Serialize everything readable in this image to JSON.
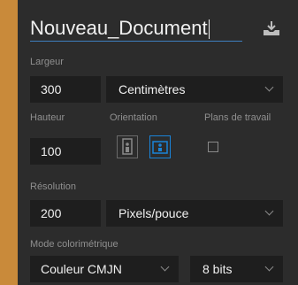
{
  "document": {
    "name": "Nouveau_Document"
  },
  "width": {
    "label": "Largeur",
    "value": "300",
    "unit": "Centimètres"
  },
  "height": {
    "label": "Hauteur",
    "value": "100"
  },
  "orientation": {
    "label": "Orientation",
    "selected": "landscape"
  },
  "artboards": {
    "label": "Plans de travail",
    "checked": false
  },
  "resolution": {
    "label": "Résolution",
    "value": "200",
    "unit": "Pixels/pouce"
  },
  "color_mode": {
    "label": "Mode colorimétrique",
    "value": "Couleur CMJN",
    "bit_depth": "8 bits"
  },
  "colors": {
    "accent": "#1a84d8",
    "panel": "#2c2c2c",
    "field": "#1e1e1e"
  }
}
